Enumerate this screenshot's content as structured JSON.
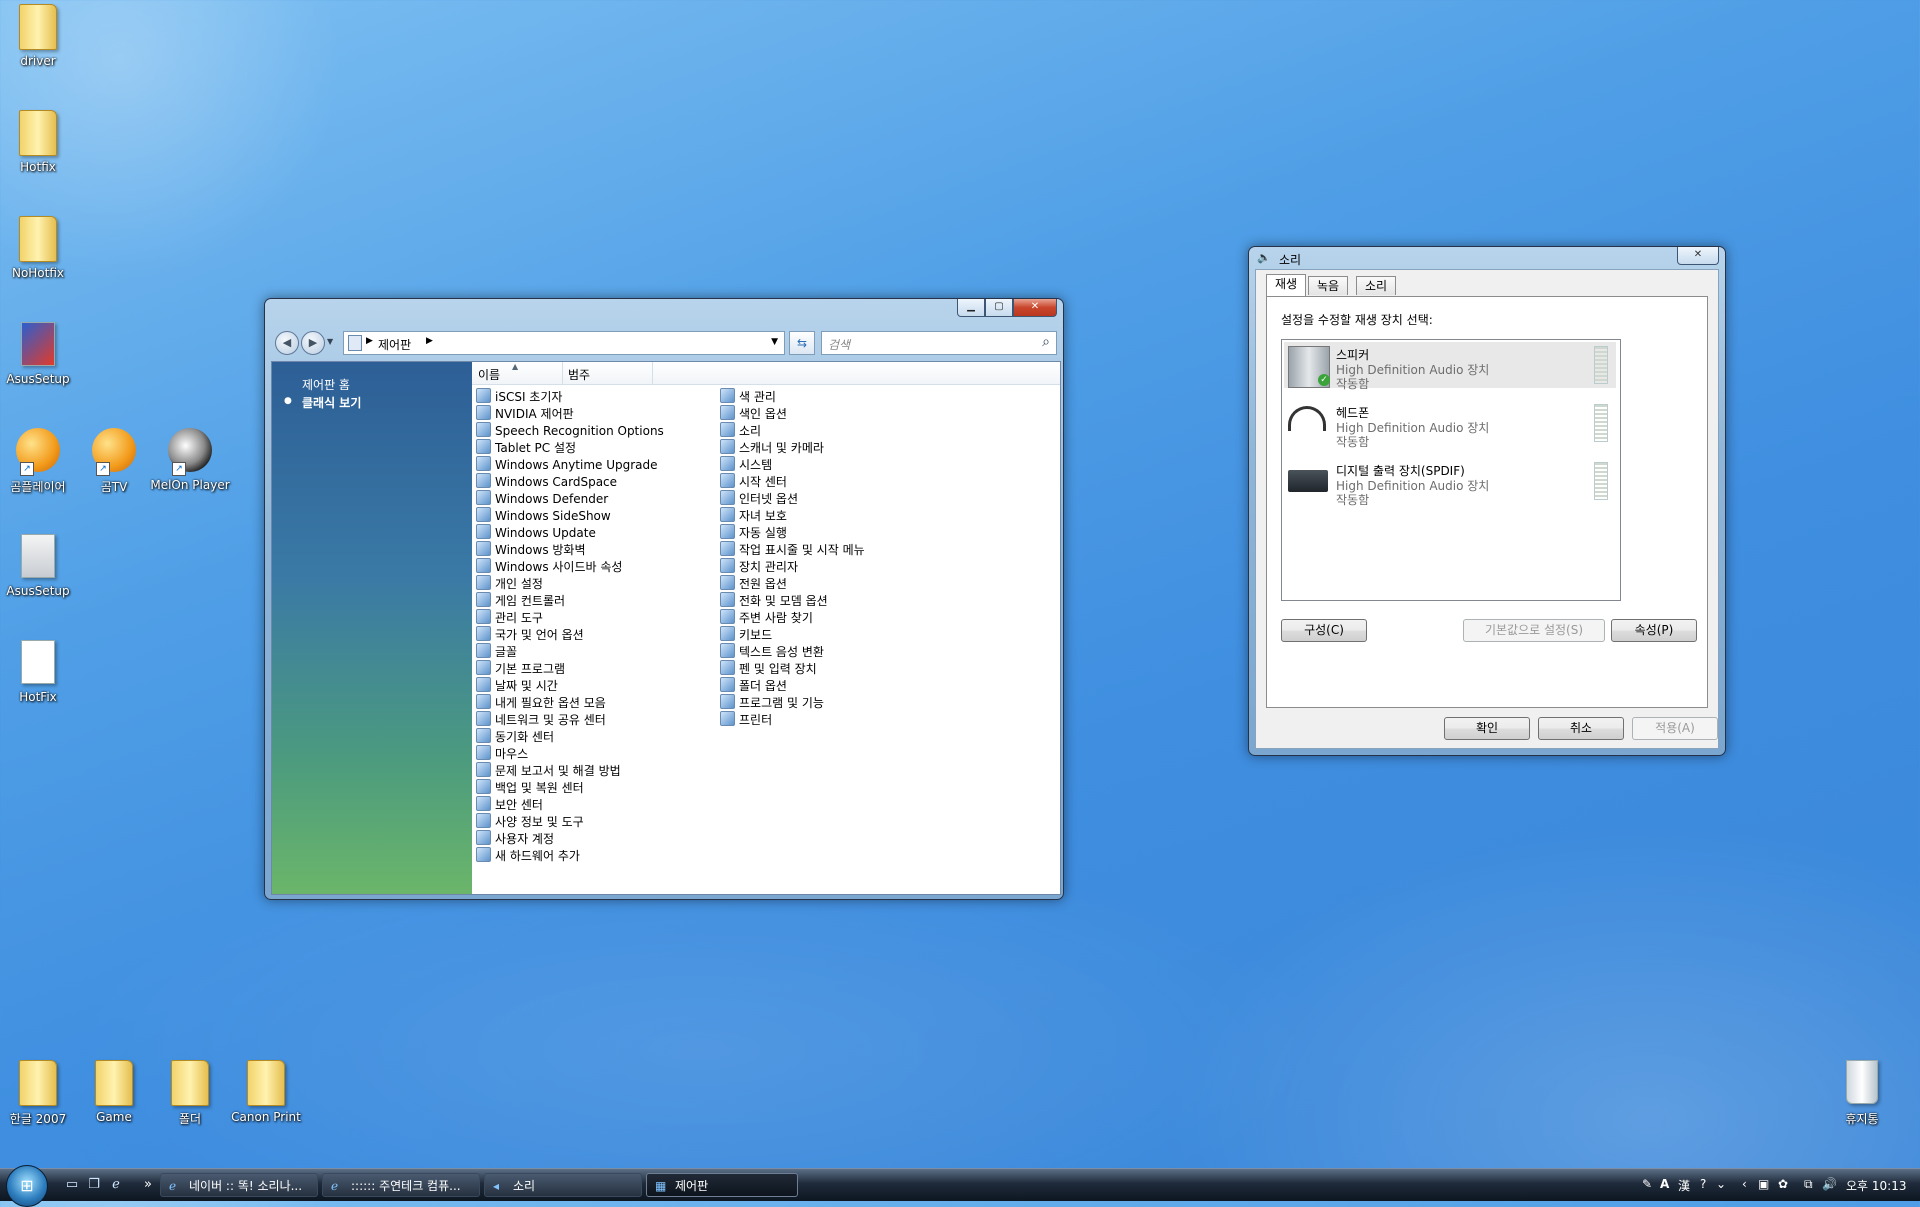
{
  "desktop": {
    "icons": [
      {
        "label": "driver",
        "type": "folder"
      },
      {
        "label": "Hotfix",
        "type": "folder"
      },
      {
        "label": "NoHotfix",
        "type": "folder"
      },
      {
        "label": "AsusSetup",
        "type": "app"
      },
      {
        "label": "곰플레이어",
        "type": "app"
      },
      {
        "label": "곰TV",
        "type": "app"
      },
      {
        "label": "MelOn Player",
        "type": "app"
      },
      {
        "label": "AsusSetup",
        "type": "setup"
      },
      {
        "label": "HotFix",
        "type": "file"
      },
      {
        "label": "한글 2007",
        "type": "folder"
      },
      {
        "label": "Game",
        "type": "folder"
      },
      {
        "label": "폴더",
        "type": "folder"
      },
      {
        "label": "Canon Print",
        "type": "folder"
      },
      {
        "label": "휴지통",
        "type": "recycle-bin"
      }
    ]
  },
  "control_panel": {
    "address": "제어판",
    "search_placeholder": "검색",
    "sidebar": {
      "home": "제어판 홈",
      "classic": "클래식 보기"
    },
    "columns": {
      "name": "이름",
      "category": "범주"
    },
    "items_col1": [
      "iSCSI 초기자",
      "NVIDIA 제어판",
      "Speech Recognition Options",
      "Tablet PC 설정",
      "Windows Anytime Upgrade",
      "Windows CardSpace",
      "Windows Defender",
      "Windows SideShow",
      "Windows Update",
      "Windows 방화벽",
      "Windows 사이드바 속성",
      "개인 설정",
      "게임 컨트롤러",
      "관리 도구",
      "국가 및 언어 옵션",
      "글꼴",
      "기본 프로그램",
      "날짜 및 시간",
      "내게 필요한 옵션 모음",
      "네트워크 및 공유 센터",
      "동기화 센터",
      "마우스",
      "문제 보고서 및 해결 방법",
      "백업 및 복원 센터",
      "보안 센터",
      "사양 정보 및 도구",
      "사용자 계정",
      "새 하드웨어 추가"
    ],
    "items_col2": [
      "색 관리",
      "색인 옵션",
      "소리",
      "스캐너 및 카메라",
      "시스템",
      "시작 센터",
      "인터넷 옵션",
      "자녀 보호",
      "자동 실행",
      "작업 표시줄 및 시작 메뉴",
      "장치 관리자",
      "전원 옵션",
      "전화 및 모뎀 옵션",
      "주변 사람 찾기",
      "키보드",
      "텍스트 음성 변환",
      "펜 및 입력 장치",
      "폴더 옵션",
      "프로그램 및 기능",
      "프린터"
    ]
  },
  "sound_dialog": {
    "title": "소리",
    "tabs": [
      "재생",
      "녹음",
      "소리"
    ],
    "instruction": "설정을 수정할 재생 장치 선택:",
    "devices": [
      {
        "name": "스피커",
        "driver": "High Definition Audio 장치",
        "status": "작동함"
      },
      {
        "name": "헤드폰",
        "driver": "High Definition Audio 장치",
        "status": "작동함"
      },
      {
        "name": "디지털 출력 장치(SPDIF)",
        "driver": "High Definition Audio 장치",
        "status": "작동함"
      }
    ],
    "configure_button": "구성(C)",
    "set_default_button": "기본값으로 설정(S)",
    "properties_button": "속성(P)",
    "ok_button": "확인",
    "cancel_button": "취소",
    "apply_button": "적용(A)"
  },
  "taskbar": {
    "tasks": [
      {
        "label": "네이버 :: 똑! 소리나..."
      },
      {
        "label": ":::::: 주연테크 컴퓨..."
      },
      {
        "label": "소리"
      },
      {
        "label": "제어판"
      }
    ],
    "clock": "오후 10:13"
  },
  "colors": {
    "accent": "#3a86d8",
    "sidebar_top": "#2d5f96",
    "sidebar_bottom": "#6bb66a"
  }
}
